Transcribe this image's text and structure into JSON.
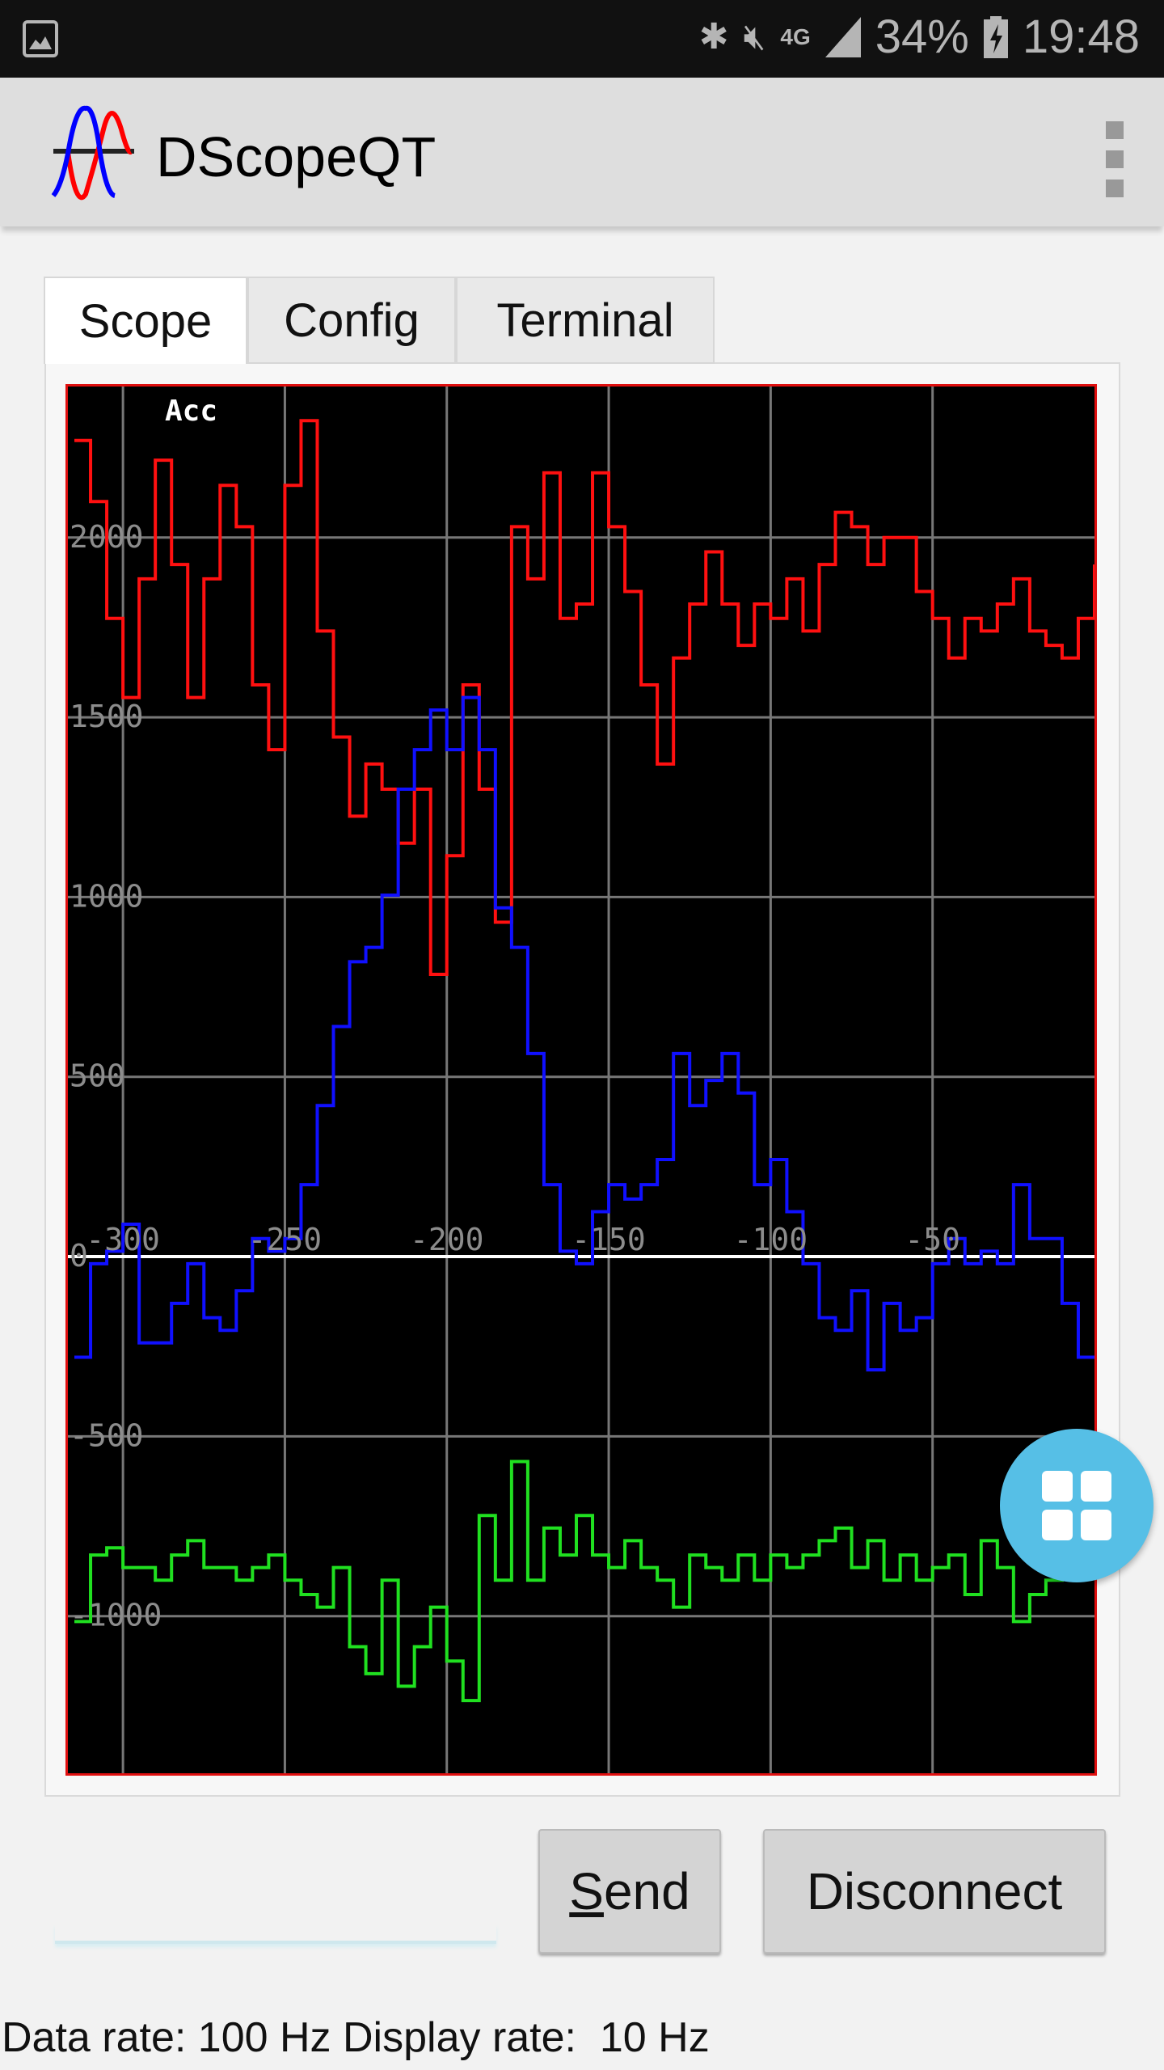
{
  "status_bar": {
    "battery": "34%",
    "time": "19:48",
    "network": "4G",
    "icons": [
      "image-icon",
      "bluetooth-icon",
      "mute-icon",
      "4g-icon",
      "signal-icon",
      "battery-charging-icon"
    ]
  },
  "app_bar": {
    "title": "DScopeQT",
    "logo": "sine-waves-logo",
    "menu_icon": "more-vert-icon"
  },
  "tabs": [
    {
      "label": "Scope",
      "active": true
    },
    {
      "label": "Config",
      "active": false
    },
    {
      "label": "Terminal",
      "active": false
    }
  ],
  "buttons": {
    "send": "Send",
    "disconnect": "Disconnect"
  },
  "input": {
    "value": ""
  },
  "fab_icon": "grid-icon",
  "footer": {
    "data_rate": "Data rate: 100 Hz",
    "display_rate": "Display rate:  10 Hz"
  },
  "chart_data": {
    "type": "line",
    "title": "Acc",
    "xlim": [
      -317,
      0
    ],
    "ylim": [
      -1437,
      2420
    ],
    "x_ticks": [
      "-300",
      "-250",
      "-200",
      "-150",
      "-100",
      "-50"
    ],
    "y_ticks": [
      "2000",
      "1500",
      "1000",
      "500",
      "0",
      "-500",
      "-1000"
    ],
    "grid": true,
    "colors": {
      "background": "#000000",
      "border": "#e01010",
      "grid": "#777777",
      "zero_line": "#ffffff",
      "tick_text": "#8c8c8c"
    },
    "x": [
      -315,
      -310,
      -305,
      -300,
      -295,
      -290,
      -285,
      -280,
      -275,
      -270,
      -265,
      -260,
      -255,
      -250,
      -245,
      -240,
      -235,
      -230,
      -225,
      -220,
      -215,
      -210,
      -205,
      -200,
      -195,
      -190,
      -185,
      -180,
      -175,
      -170,
      -165,
      -160,
      -155,
      -150,
      -145,
      -140,
      -135,
      -130,
      -125,
      -120,
      -115,
      -110,
      -105,
      -100,
      -95,
      -90,
      -85,
      -80,
      -75,
      -70,
      -65,
      -60,
      -55,
      -50,
      -45,
      -40,
      -35,
      -30,
      -25,
      -20,
      -15,
      -10,
      -5,
      0
    ],
    "series": [
      {
        "color": "#ff1010",
        "values": [
          2270,
          2100,
          1775,
          1555,
          1885,
          2215,
          1925,
          1555,
          1885,
          2145,
          2030,
          1590,
          1410,
          2145,
          2325,
          1740,
          1445,
          1225,
          1370,
          1300,
          1150,
          1300,
          785,
          1115,
          1590,
          1300,
          930,
          2030,
          1885,
          2180,
          1775,
          1815,
          2180,
          2030,
          1850,
          1590,
          1370,
          1665,
          1815,
          1960,
          1815,
          1700,
          1815,
          1775,
          1885,
          1740,
          1925,
          2070,
          2030,
          1925,
          2000,
          2000,
          1850,
          1775,
          1665,
          1775,
          1740,
          1815,
          1885,
          1740,
          1700,
          1665,
          1775,
          1925
        ]
      },
      {
        "color": "#1010ff",
        "values": [
          -280,
          -20,
          15,
          90,
          -240,
          -240,
          -130,
          -20,
          -170,
          -205,
          -95,
          50,
          15,
          50,
          200,
          420,
          640,
          820,
          860,
          1005,
          1300,
          1410,
          1520,
          1410,
          1555,
          1410,
          970,
          860,
          565,
          200,
          15,
          -20,
          125,
          200,
          160,
          200,
          270,
          565,
          420,
          490,
          565,
          455,
          200,
          270,
          125,
          -20,
          -170,
          -205,
          -95,
          -315,
          -130,
          -205,
          -170,
          -20,
          50,
          -20,
          15,
          -20,
          200,
          50,
          50,
          -130,
          -280,
          -280
        ]
      },
      {
        "color": "#20e020",
        "values": [
          -1015,
          -830,
          -810,
          -865,
          -865,
          -900,
          -830,
          -790,
          -865,
          -865,
          -900,
          -865,
          -830,
          -900,
          -940,
          -975,
          -865,
          -1085,
          -1160,
          -900,
          -1195,
          -1085,
          -975,
          -1125,
          -1235,
          -720,
          -900,
          -570,
          -900,
          -755,
          -830,
          -720,
          -830,
          -865,
          -790,
          -865,
          -900,
          -975,
          -830,
          -865,
          -900,
          -830,
          -900,
          -830,
          -865,
          -830,
          -790,
          -755,
          -865,
          -790,
          -900,
          -830,
          -900,
          -865,
          -830,
          -940,
          -790,
          -865,
          -1015,
          -940,
          -900,
          -865,
          -865,
          -830
        ]
      }
    ]
  }
}
